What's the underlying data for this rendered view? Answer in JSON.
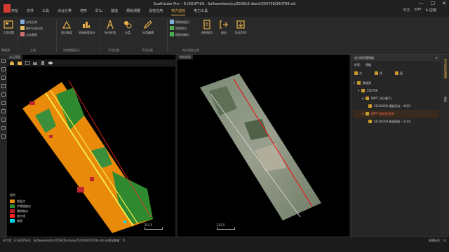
{
  "window": {
    "title": "SouthLidar Pro -- E:/SOUTH/A、Softwaretest/cs/250616-dianli/250709/250709.sld",
    "minimize": "—",
    "maximize": "☐",
    "close": "✕"
  },
  "menu": {
    "items": [
      "开始",
      "文件",
      "工具",
      "点云分类",
      "地形",
      "矿山",
      "隧道",
      "倾斜测量",
      "巡检应用",
      "电力巡检",
      "电力工具"
    ],
    "active_index": 9,
    "right": [
      "中文",
      "SHP",
      "& 应用"
    ]
  },
  "ribbon": {
    "groups": [
      {
        "label": "数据源",
        "buttons": [
          "工程设置"
        ]
      },
      {
        "label": "工具",
        "small": [
          "自动工具",
          "按中心线分块",
          "点云裁剪"
        ]
      },
      {
        "label": "初始数据显示",
        "buttons": [
          "相对高度",
          "初始高度显示"
        ]
      },
      {
        "label": "手动分类",
        "buttons": [
          "标记杆塔",
          "分类"
        ]
      },
      {
        "label": "手动分类",
        "buttons": [
          "分类编辑"
        ]
      },
      {
        "label": "电力巡检工具",
        "small": [
          "提取地面点",
          "提取两点",
          "提取风偏点"
        ],
        "buttons": [
          "巡检报告",
          "退出",
          "导出DXD"
        ]
      }
    ]
  },
  "views": {
    "left": {
      "tab": "点云视图",
      "scale": "212.5"
    },
    "right": {
      "tab": "影像视图",
      "scale": "212.5"
    }
  },
  "legend": {
    "title": "图例",
    "items": [
      {
        "label": "地面点",
        "color": "#e88a0a"
      },
      {
        "label": "中等植被点",
        "color": "#2e8b2e"
      },
      {
        "label": "建筑物点",
        "color": "#b8202a"
      },
      {
        "label": "电力线",
        "color": "#ff2020"
      },
      {
        "label": "铁塔",
        "color": "#00d8e8"
      }
    ]
  },
  "right_panel": {
    "title": "电力巡检管理器",
    "filter": {
      "label": "检索：",
      "value": "图幅",
      "options": [
        "点",
        "线",
        "面"
      ]
    },
    "tree": [
      {
        "label": "数据源",
        "level": 0,
        "checked": true,
        "selected": false
      },
      {
        "label": "250709",
        "level": 1,
        "checked": true,
        "selected": false
      },
      {
        "label": "RPPT 点扫描[5]",
        "level": 2,
        "checked": true,
        "selected": false
      },
      {
        "label": "S1030006 横梁顶点 - 40[2]",
        "level": 3,
        "checked": true,
        "selected": false
      },
      {
        "label": "RPPT 巡检项目[0]",
        "level": 2,
        "checked": true,
        "selected": true
      },
      {
        "label": "S1030309 截面图表 - 21[0]",
        "level": 3,
        "checked": true,
        "selected": false
      }
    ]
  },
  "right_tabs": [
    "电力巡检管理器",
    "属性"
  ],
  "status": {
    "left": "环工程：E:/SOUTH/A、Softwaretest/cs/250616-dianli/250709/250709.sld (未保存数据：7)",
    "right": "视图标签：14"
  }
}
